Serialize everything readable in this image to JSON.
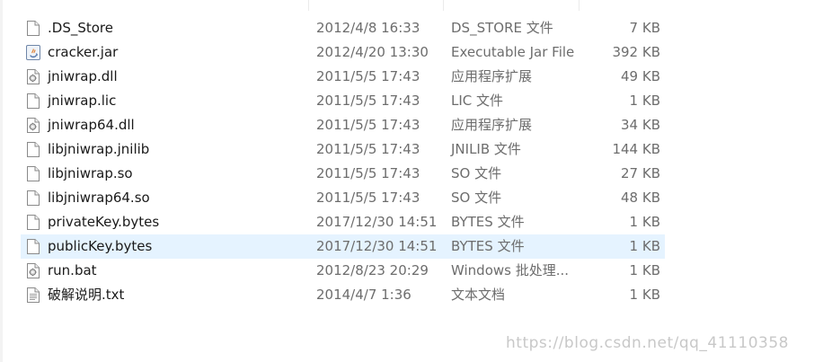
{
  "files": [
    {
      "name": ".DS_Store",
      "date": "2012/4/8 16:33",
      "type": "DS_STORE 文件",
      "size": "7 KB",
      "icon": "blank-file-icon",
      "selected": false
    },
    {
      "name": "cracker.jar",
      "date": "2012/4/20 13:30",
      "type": "Executable Jar File",
      "size": "392 KB",
      "icon": "java-jar-icon",
      "selected": false
    },
    {
      "name": "jniwrap.dll",
      "date": "2011/5/5 17:43",
      "type": "应用程序扩展",
      "size": "49 KB",
      "icon": "dll-gear-file-icon",
      "selected": false
    },
    {
      "name": "jniwrap.lic",
      "date": "2011/5/5 17:43",
      "type": "LIC 文件",
      "size": "1 KB",
      "icon": "blank-file-icon",
      "selected": false
    },
    {
      "name": "jniwrap64.dll",
      "date": "2011/5/5 17:43",
      "type": "应用程序扩展",
      "size": "34 KB",
      "icon": "dll-gear-file-icon",
      "selected": false
    },
    {
      "name": "libjniwrap.jnilib",
      "date": "2011/5/5 17:43",
      "type": "JNILIB 文件",
      "size": "144 KB",
      "icon": "blank-file-icon",
      "selected": false
    },
    {
      "name": "libjniwrap.so",
      "date": "2011/5/5 17:43",
      "type": "SO 文件",
      "size": "27 KB",
      "icon": "blank-file-icon",
      "selected": false
    },
    {
      "name": "libjniwrap64.so",
      "date": "2011/5/5 17:43",
      "type": "SO 文件",
      "size": "48 KB",
      "icon": "blank-file-icon",
      "selected": false
    },
    {
      "name": "privateKey.bytes",
      "date": "2017/12/30 14:51",
      "type": "BYTES 文件",
      "size": "1 KB",
      "icon": "blank-file-icon",
      "selected": false
    },
    {
      "name": "publicKey.bytes",
      "date": "2017/12/30 14:51",
      "type": "BYTES 文件",
      "size": "1 KB",
      "icon": "blank-file-icon",
      "selected": true
    },
    {
      "name": "run.bat",
      "date": "2012/8/23 20:29",
      "type": "Windows 批处理...",
      "size": "1 KB",
      "icon": "batch-gear-file-icon",
      "selected": false
    },
    {
      "name": "破解说明.txt",
      "date": "2014/4/7 1:36",
      "type": "文本文档",
      "size": "1 KB",
      "icon": "text-file-icon",
      "selected": false
    }
  ],
  "watermark": "https://blog.csdn.net/qq_41110358",
  "colors": {
    "selected_row": "#e5f3ff",
    "secondary_text": "#6d6d6d",
    "primary_text": "#1a1a1a"
  }
}
